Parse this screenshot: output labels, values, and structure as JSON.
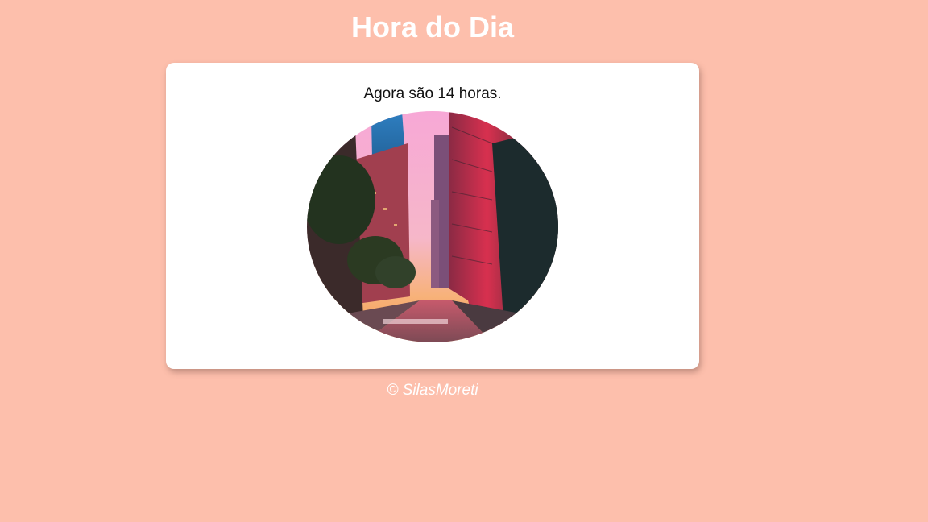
{
  "header": {
    "title": "Hora do Dia"
  },
  "card": {
    "message": "Agora são 14 horas.",
    "image": {
      "subject": "city street at dusk",
      "icon": "street-photo"
    }
  },
  "footer": {
    "text": "© SilasMoreti"
  },
  "colors": {
    "background": "#fdbfac",
    "card": "#ffffff",
    "title": "#ffffff",
    "message": "#111111"
  }
}
